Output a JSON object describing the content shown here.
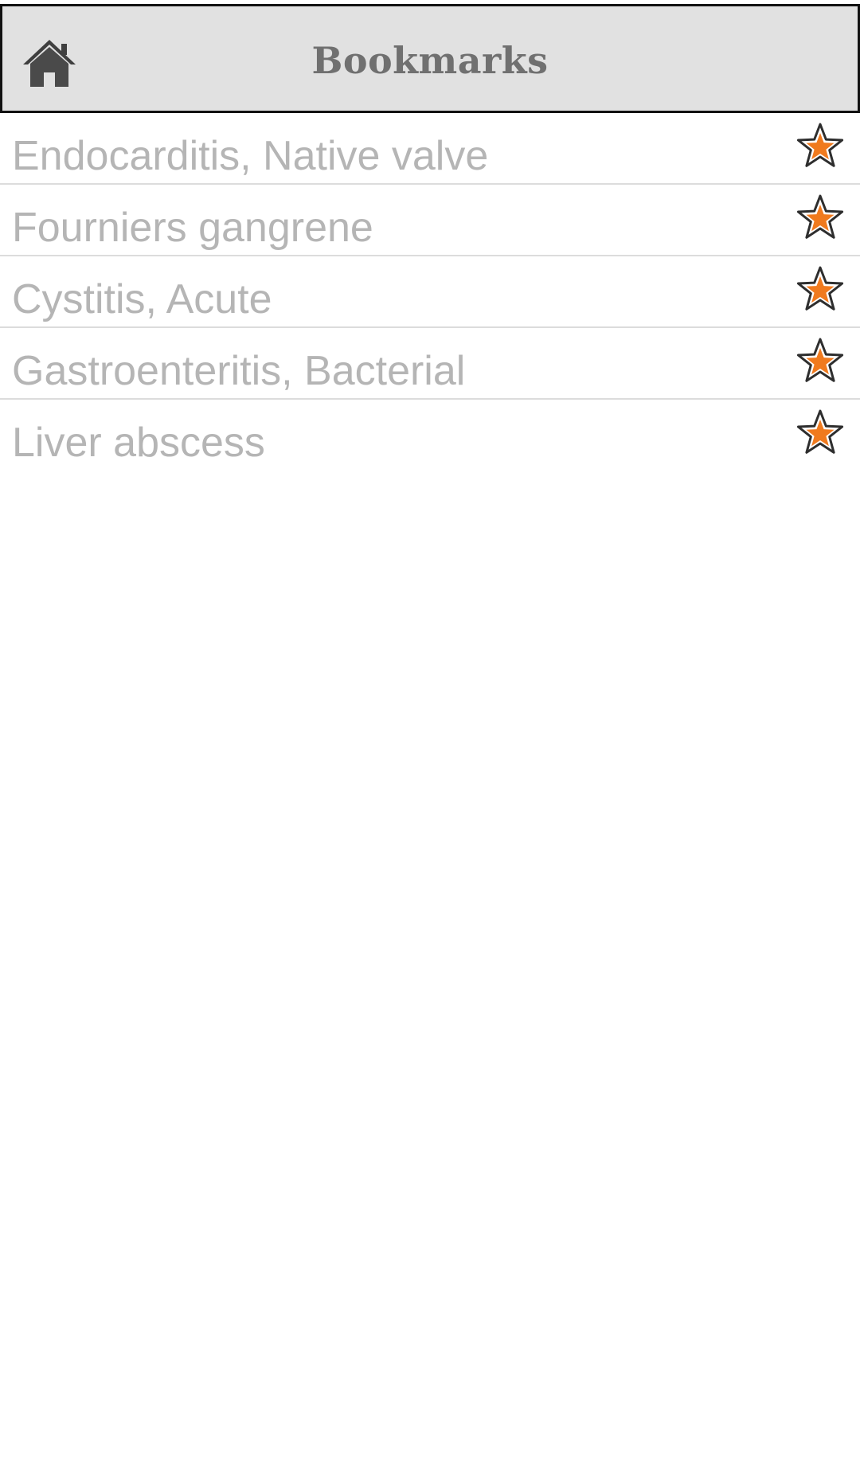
{
  "header": {
    "title": "Bookmarks",
    "home_icon": "home-icon",
    "background_color": "#e1e1e1",
    "title_color": "#707070"
  },
  "bookmarks": {
    "items": [
      {
        "label": "Endocarditis, Native valve",
        "icon": "star-icon"
      },
      {
        "label": "Fourniers gangrene",
        "icon": "star-icon"
      },
      {
        "label": "Cystitis, Acute",
        "icon": "star-icon"
      },
      {
        "label": "Gastroenteritis, Bacterial",
        "icon": "star-icon"
      },
      {
        "label": "Liver abscess",
        "icon": "star-icon"
      }
    ],
    "text_color": "#b5b5b5",
    "star_color": "#f07a1e"
  }
}
